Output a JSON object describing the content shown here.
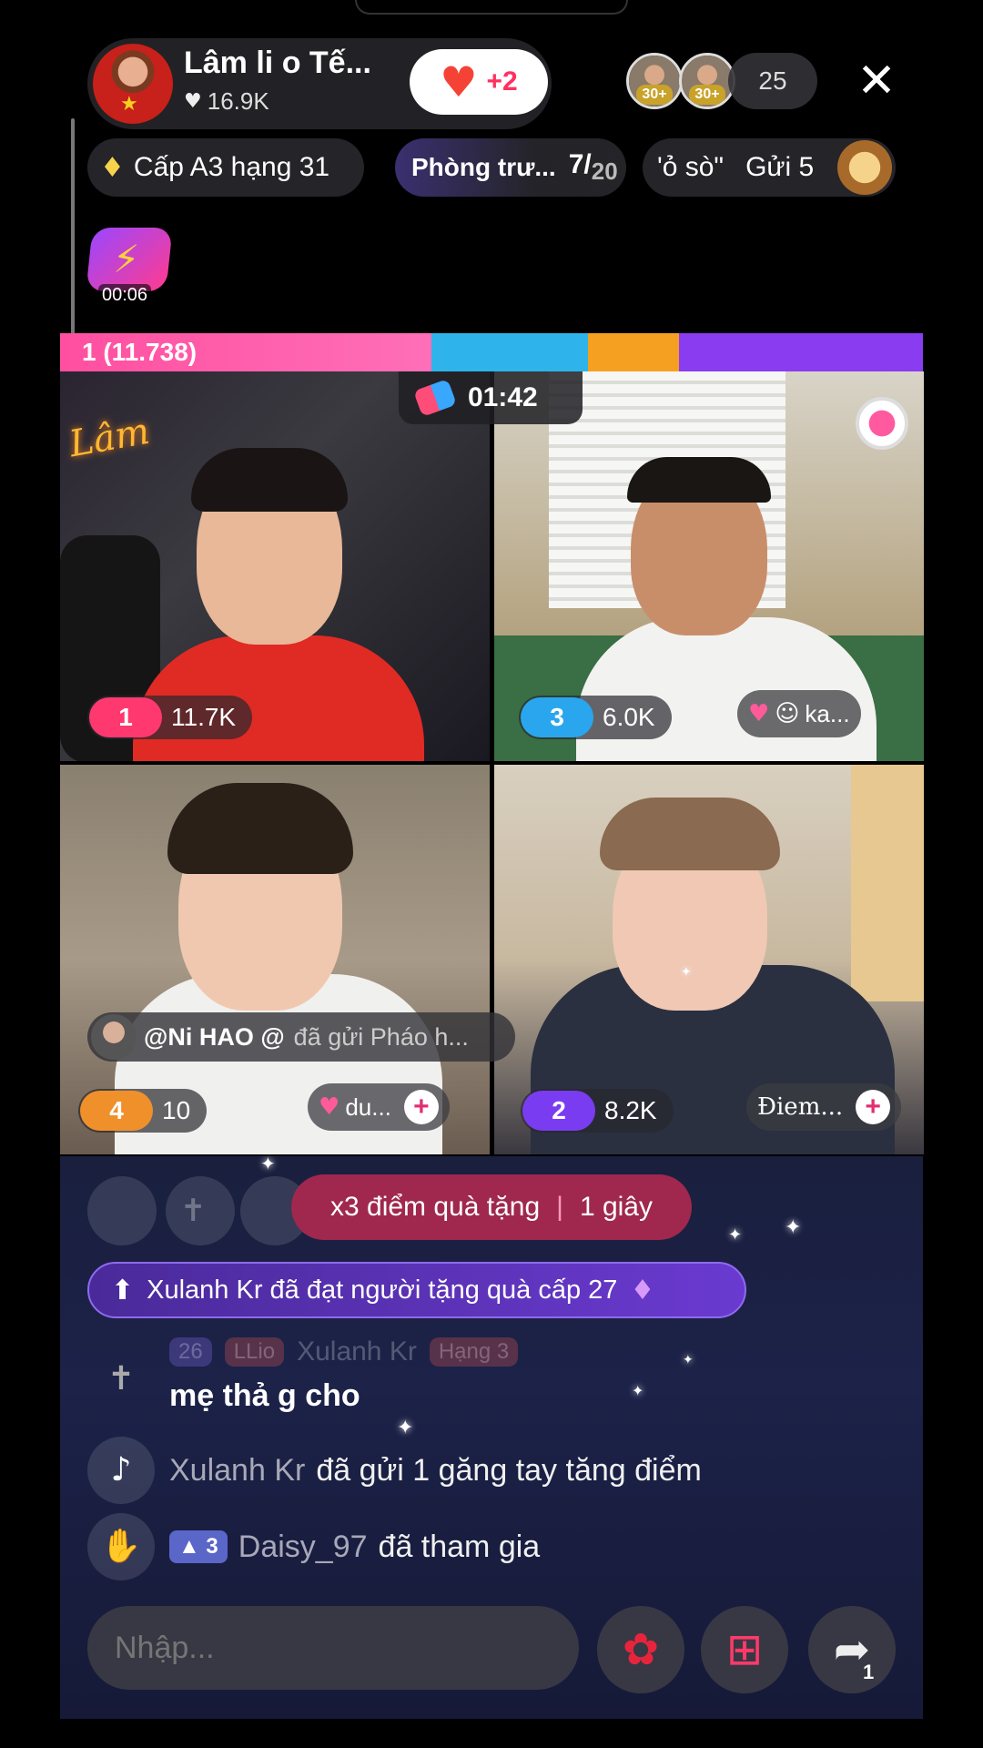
{
  "host": {
    "name": "Lâm li o Tế...",
    "likes": "16.9K",
    "follow_plus": "+2"
  },
  "viewers": {
    "avatars": [
      {
        "age": "30+"
      },
      {
        "age": "30+"
      }
    ],
    "count": "25"
  },
  "chips": {
    "level": "Cấp A3 hạng 31",
    "room_label": "Phòng trư...",
    "room_count": "7",
    "room_total": "20",
    "gift_label": "'ỏ sò\"",
    "gift_action": "Gửi 5"
  },
  "flash_badge": {
    "timer": "00:06"
  },
  "battle": {
    "leader_score": "1 (11.738)",
    "timer": "01:42"
  },
  "tiles": [
    {
      "rank": "1",
      "score": "11.7K",
      "rank_color": "#ff3870"
    },
    {
      "rank": "3",
      "score": "6.0K",
      "rank_color": "#2aa6ee",
      "fan": "ka..."
    },
    {
      "rank": "4",
      "score": "10",
      "rank_color": "#f0902a",
      "fan": "du..."
    },
    {
      "rank": "2",
      "score": "8.2K",
      "rank_color": "#7a3cf0",
      "fan": "Điem..."
    }
  ],
  "notice": {
    "user": "@Ni HAO @",
    "text": "đã gửi Pháo h..."
  },
  "multiplier": {
    "text": "x3 điểm quà tặng",
    "time": "1 giây"
  },
  "level_banner": "Xulanh Kr đã đạt người tặng quà cấp 27",
  "faded_line": {
    "level": "26",
    "badge": "LLio",
    "user": "Xulanh Kr",
    "rank": "Hạng 3"
  },
  "chat": [
    {
      "text": "mẹ thả g cho"
    },
    {
      "user": "Xulanh Kr",
      "text": "đã gửi 1 găng tay tăng điểm"
    },
    {
      "level": "3",
      "user": "Daisy_97",
      "text": "đã tham gia"
    }
  ],
  "input": {
    "placeholder": "Nhập..."
  },
  "share_count": "1"
}
